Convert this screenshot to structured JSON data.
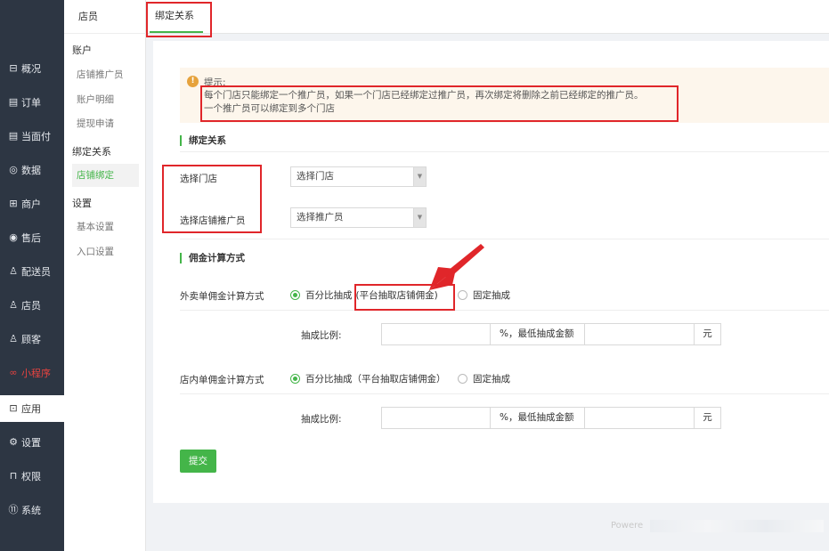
{
  "nav": {
    "items": [
      {
        "label": "概况",
        "icon": "overview-icon"
      },
      {
        "label": "订单",
        "icon": "order-icon"
      },
      {
        "label": "当面付",
        "icon": "pay-icon"
      },
      {
        "label": "数据",
        "icon": "data-icon"
      },
      {
        "label": "商户",
        "icon": "merchant-icon"
      },
      {
        "label": "售后",
        "icon": "after-sale-icon"
      },
      {
        "label": "配送员",
        "icon": "courier-icon"
      },
      {
        "label": "店员",
        "icon": "clerk-icon"
      },
      {
        "label": "顾客",
        "icon": "customer-icon"
      },
      {
        "label": "小程序",
        "icon": "miniprogram-icon"
      },
      {
        "label": "应用",
        "icon": "app-icon"
      },
      {
        "label": "设置",
        "icon": "settings-icon"
      },
      {
        "label": "权限",
        "icon": "lock-icon"
      },
      {
        "label": "系统",
        "icon": "system-icon"
      }
    ]
  },
  "subnav": {
    "title": "店员",
    "group_account": "账户",
    "item_promoter": "店铺推广员",
    "item_detail": "账户明细",
    "item_withdraw": "提现申请",
    "group_bind": "绑定关系",
    "item_shopbind": "店铺绑定",
    "group_settings": "设置",
    "item_basic": "基本设置",
    "item_entry": "入口设置"
  },
  "topbar": {
    "tab": "绑定关系"
  },
  "tip": {
    "title": "提示:",
    "line1": "每个门店只能绑定一个推广员，如果一个门店已经绑定过推广员，再次绑定将删除之前已经绑定的推广员。",
    "line2": "一个推广员可以绑定到多个门店"
  },
  "bind": {
    "section": "绑定关系",
    "store_label": "选择门店",
    "store_value": "选择门店",
    "promoter_label": "选择店铺推广员",
    "promoter_value": "选择推广员"
  },
  "commission": {
    "section": "佣金计算方式",
    "takeout_label": "外卖单佣金计算方式",
    "instore_label": "店内单佣金计算方式",
    "opt_percent": "百分比抽成",
    "opt_percent_note": "(平台抽取店铺佣金)",
    "opt_percent_full": "百分比抽成（平台抽取店铺佣金）",
    "opt_fixed": "固定抽成",
    "rate_label": "抽成比例:",
    "rate_addon": "%，最低抽成金额",
    "yuan": "元"
  },
  "submit": "提交",
  "footer": "Powere"
}
